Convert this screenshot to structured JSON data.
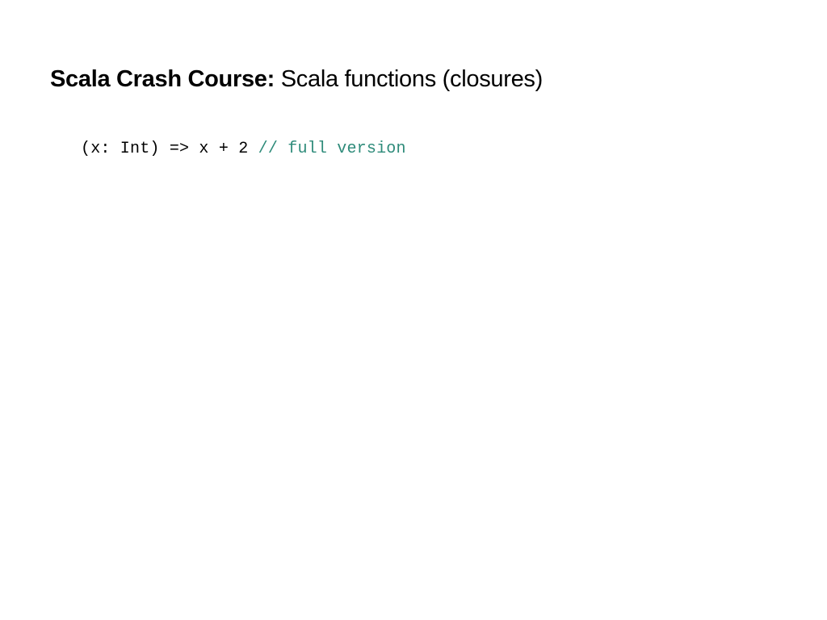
{
  "title": {
    "bold": "Scala Crash Course:",
    "regular": " Scala functions (closures)"
  },
  "code": {
    "line1_code": "(x: Int) => x + 2 ",
    "line1_comment": "// full version"
  }
}
